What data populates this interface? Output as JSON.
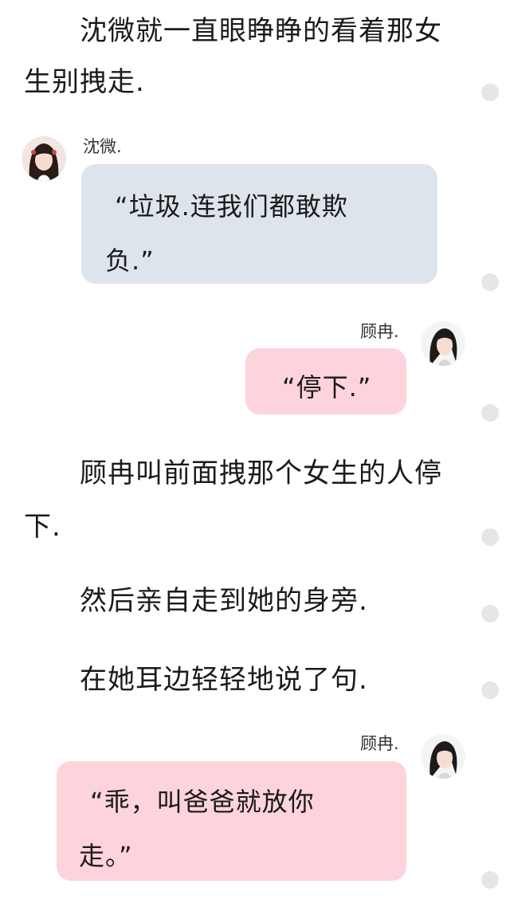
{
  "narration": [
    "沈微就一直眼睁睁的看着那女",
    "生别拽走.",
    "顾冉叫前面拽那个女生的人停",
    "下.",
    "然后亲自走到她的身旁.",
    "在她耳边轻轻地说了句."
  ],
  "messages": [
    {
      "speaker": "沈微.",
      "side": "left",
      "lines": [
        "“垃圾.连我们都敢欺",
        "负.”"
      ],
      "bubble_color": "#dde4ec",
      "avatar_icon": "girl-avatar-icon"
    },
    {
      "speaker": "顾冉.",
      "side": "right",
      "lines": [
        "“停下.”"
      ],
      "bubble_color": "#fdd3dc",
      "avatar_icon": "girl-avatar-icon"
    },
    {
      "speaker": "顾冉.",
      "side": "right",
      "lines": [
        "“乖，叫爸爸就放你",
        "走。”"
      ],
      "bubble_color": "#fdd3dc",
      "avatar_icon": "girl-avatar-icon"
    }
  ],
  "scroll_dots": 9
}
